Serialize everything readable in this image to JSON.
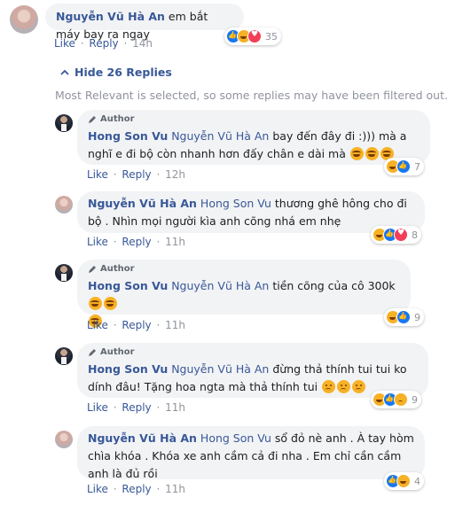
{
  "top_comment": {
    "author": "Nguyễn Vũ Hà An",
    "text": "em bắt máy bay ra ngay",
    "like": "Like",
    "reply": "Reply",
    "dot": "·",
    "time": "14h",
    "reaction_count": "35",
    "reactions": [
      "like",
      "haha",
      "love"
    ]
  },
  "replies_toggle": {
    "label": "Hide 26 Replies"
  },
  "filter_note": "Most Relevant is selected, so some replies may have been filtered out.",
  "replies": [
    {
      "author_badge": "Author",
      "author": "Hong Son Vu",
      "mention": "Nguyễn Vũ Hà An",
      "text": "bay đến đây đi :))) mà a nghĩ e đi bộ còn nhanh hơn đấy chân e dài mà",
      "like": "Like",
      "reply": "Reply",
      "time": "12h",
      "reaction_count": "7",
      "reactions": [
        "haha",
        "like"
      ]
    },
    {
      "author": "Nguyễn Vũ Hà An",
      "mention": "Hong Son Vu",
      "text": "thương ghê hông cho đi bộ . Nhìn mọi người kìa anh cõng nhá em nhẹ",
      "like": "Like",
      "reply": "Reply",
      "time": "11h",
      "reaction_count": "8",
      "reactions": [
        "haha",
        "like",
        "love"
      ]
    },
    {
      "author_badge": "Author",
      "author": "Hong Son Vu",
      "mention": "Nguyễn Vũ Hà An",
      "text": "tiền cõng của cô 300k",
      "like": "Like",
      "reply": "Reply",
      "time": "11h",
      "reaction_count": "9",
      "reactions": [
        "haha",
        "like"
      ]
    },
    {
      "author_badge": "Author",
      "author": "Hong Son Vu",
      "mention": "Nguyễn Vũ Hà An",
      "text": "đừng thả thính tui tui ko dính đâu! Tặng hoa ngta mà thả thính tui",
      "like": "Like",
      "reply": "Reply",
      "time": "11h",
      "reaction_count": "9",
      "reactions": [
        "haha",
        "like",
        "sad"
      ]
    },
    {
      "author": "Nguyễn Vũ Hà An",
      "mention": "Hong Son Vu",
      "text": "sổ đỏ nè anh . À tay hòm chìa khóa . Khóa xe anh cầm cả đi nha . Em chỉ cần cầm anh là đủ rồi",
      "like": "Like",
      "reply": "Reply",
      "time": "11h",
      "reaction_count": "4",
      "reactions": [
        "like",
        "haha"
      ]
    }
  ]
}
